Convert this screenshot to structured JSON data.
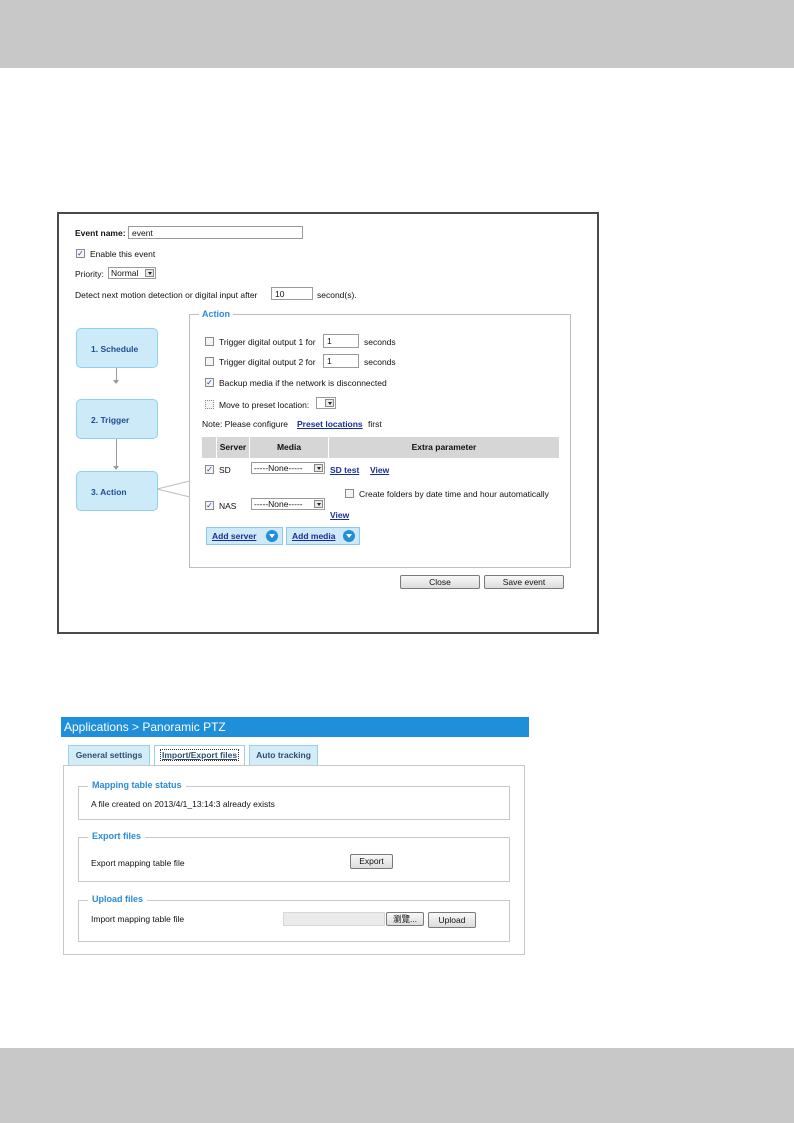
{
  "event": {
    "name_label": "Event name:",
    "name_value": "event",
    "enable_label": "Enable this event",
    "priority_label": "Priority:",
    "priority_value": "Normal",
    "detect_label": "Detect next motion detection or digital input after",
    "detect_value": "10",
    "detect_unit": "second(s).",
    "steps": [
      "1.  Schedule",
      "2.  Trigger",
      "3.  Action"
    ],
    "action": {
      "legend": "Action",
      "do1_label": "Trigger digital output 1 for",
      "do1_value": "1",
      "do2_label": "Trigger digital output 2 for",
      "do2_value": "1",
      "seconds": "seconds",
      "backup_label": "Backup media if the network is disconnected",
      "preset_label": "Move to preset location:",
      "note_prefix": "Note: Please configure",
      "note_link": "Preset locations",
      "note_suffix": "first",
      "columns": [
        "Server",
        "Media",
        "Extra parameter"
      ],
      "rows": [
        {
          "server": "SD",
          "media": "-----None-----",
          "test_link": "SD test",
          "view_link": "View"
        },
        {
          "server": "NAS",
          "media": "-----None-----",
          "folders_label": "Create folders by date time and hour automatically",
          "view_link": "View"
        }
      ],
      "add_server": "Add server",
      "add_media": "Add media"
    },
    "close_button": "Close",
    "save_button": "Save event"
  },
  "app": {
    "title": "Applications  > Panoramic PTZ",
    "tabs": [
      "General settings",
      "Import/Export files",
      "Auto tracking"
    ],
    "mapping": {
      "legend": "Mapping table status",
      "text": "A file created on 2013/4/1_13:14:3 already exists"
    },
    "export": {
      "legend": "Export files",
      "label": "Export mapping table file",
      "button": "Export"
    },
    "upload": {
      "legend": "Upload files",
      "label": "Import mapping table file",
      "browse": "瀏覽...",
      "button": "Upload"
    }
  }
}
